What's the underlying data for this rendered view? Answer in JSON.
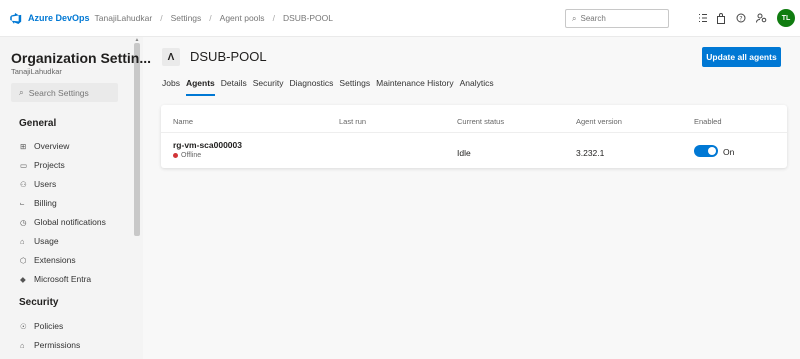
{
  "colors": {
    "accent": "#0078d4",
    "offline": "#d13438",
    "avatar_bg": "#107c10"
  },
  "topbar": {
    "brand": "Azure DevOps",
    "org": "TanajiLahudkar",
    "breadcrumbs": [
      "Settings",
      "Agent pools",
      "DSUB-POOL"
    ],
    "search_placeholder": "Search",
    "icons": [
      "list-icon",
      "shopping-bag-icon",
      "help-icon",
      "user-settings-icon"
    ],
    "avatar_initials": "TL"
  },
  "sidebar": {
    "title": "Organization Settin...",
    "subtitle": "TanajiLahudkar",
    "search_placeholder": "Search Settings",
    "sections": [
      {
        "heading": "General",
        "items": [
          {
            "label": "Overview",
            "icon": "grid-icon"
          },
          {
            "label": "Projects",
            "icon": "projects-icon"
          },
          {
            "label": "Users",
            "icon": "users-icon"
          },
          {
            "label": "Billing",
            "icon": "cart-icon"
          },
          {
            "label": "Global notifications",
            "icon": "clock-icon"
          },
          {
            "label": "Usage",
            "icon": "usage-icon"
          },
          {
            "label": "Extensions",
            "icon": "extensions-icon"
          },
          {
            "label": "Microsoft Entra",
            "icon": "diamond-icon"
          }
        ]
      },
      {
        "heading": "Security",
        "items": [
          {
            "label": "Policies",
            "icon": "lightbulb-icon"
          },
          {
            "label": "Permissions",
            "icon": "lock-icon"
          }
        ]
      }
    ]
  },
  "main": {
    "pool_title": "DSUB-POOL",
    "update_button": "Update all agents",
    "tabs": [
      "Jobs",
      "Agents",
      "Details",
      "Security",
      "Diagnostics",
      "Settings",
      "Maintenance History",
      "Analytics"
    ],
    "active_tab": "Agents",
    "table": {
      "headers": [
        "Name",
        "Last run",
        "Current status",
        "Agent version",
        "Enabled"
      ],
      "rows": [
        {
          "name": "rg-vm-sca000003",
          "status": "Offline",
          "last_run": "",
          "current_status": "Idle",
          "agent_version": "3.232.1",
          "enabled": true,
          "enabled_label": "On"
        }
      ]
    }
  }
}
